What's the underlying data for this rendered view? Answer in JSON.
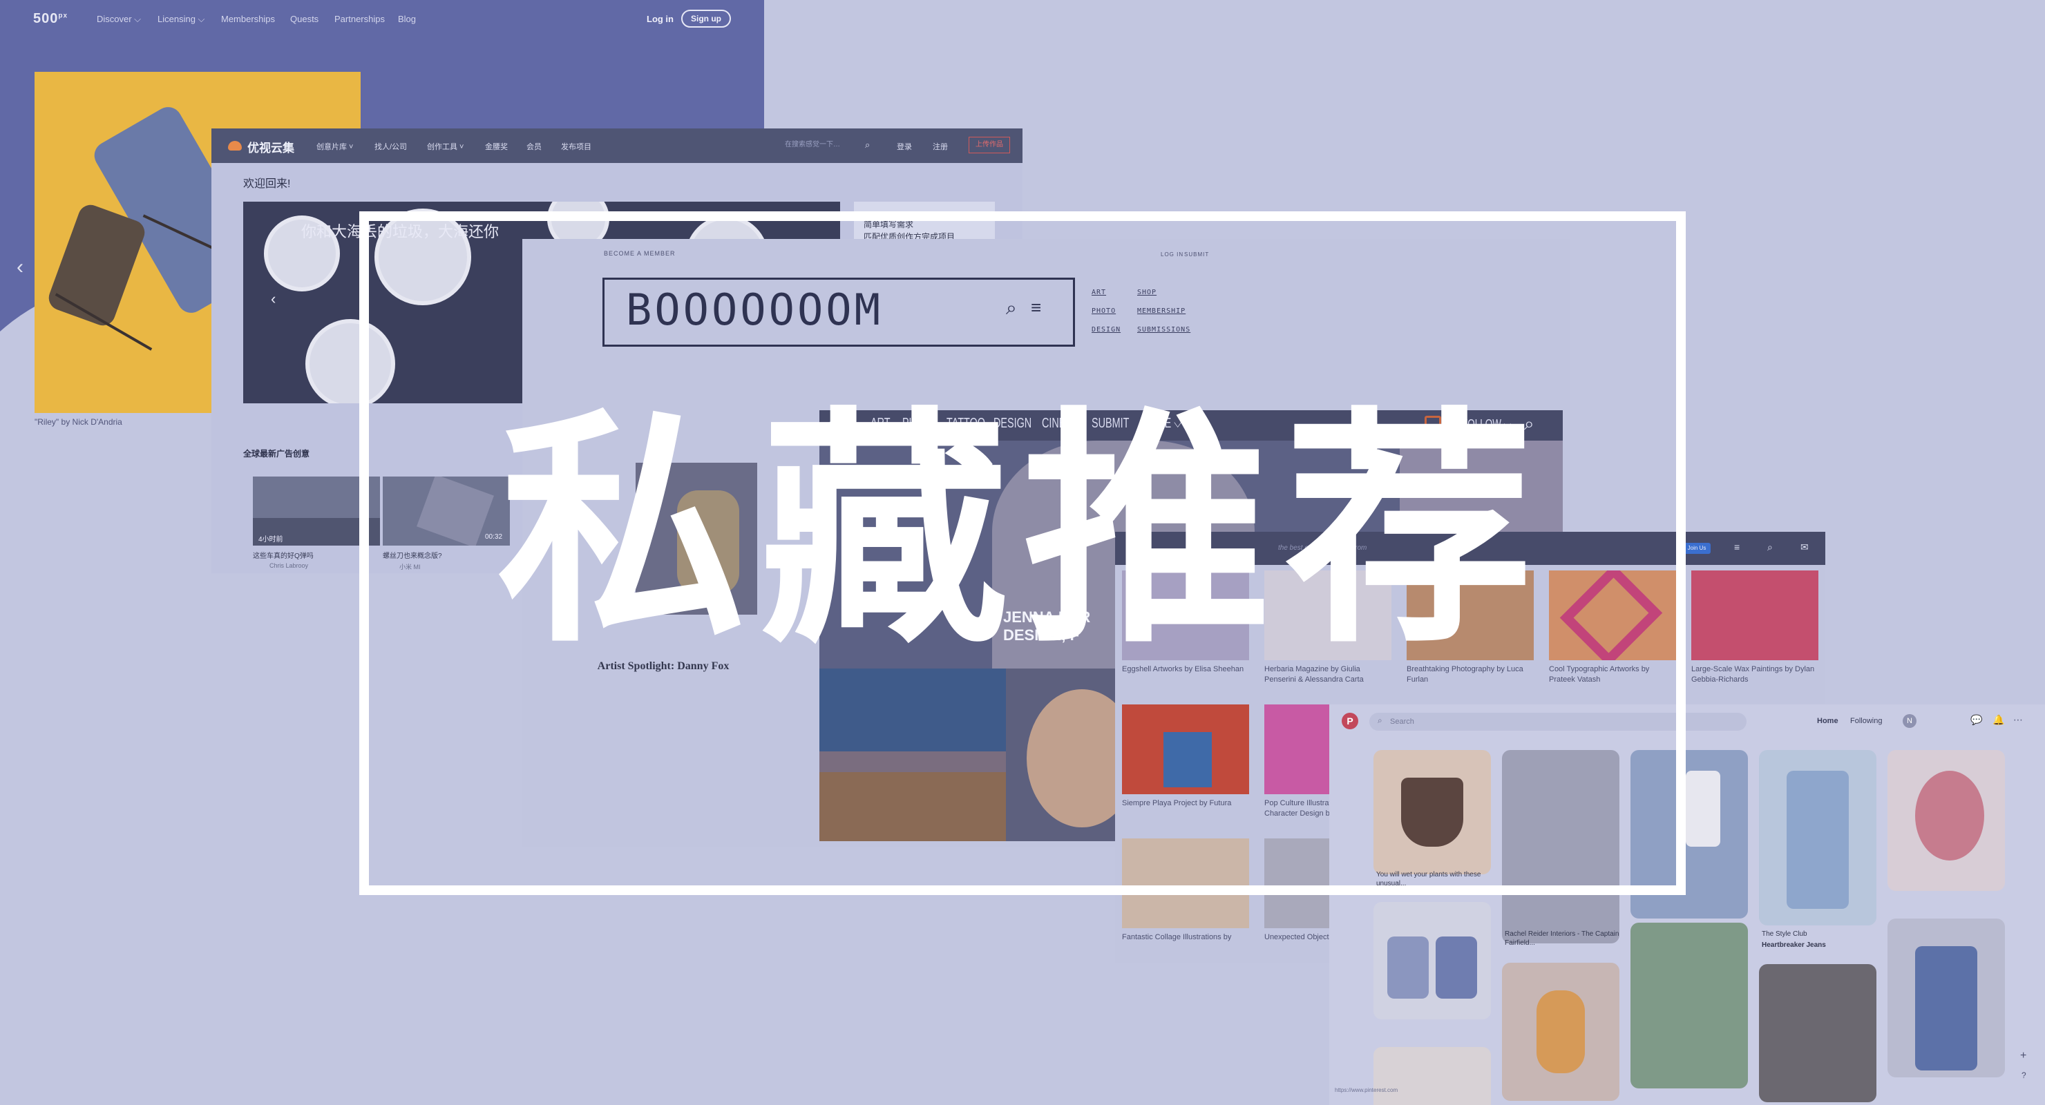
{
  "colors": {
    "background": "#c2c6e0",
    "overlay_text": "#ffffff",
    "accent_500px": "#6169a6",
    "pinterest_red": "#c2485b"
  },
  "site_500px": {
    "logo": "500",
    "logo_sup": "px",
    "nav": [
      "Discover ⌵",
      "Licensing ⌵",
      "Memberships",
      "Quests",
      "Partnerships",
      "Blog"
    ],
    "login": "Log in",
    "signup": "Sign up",
    "caption": "\"Riley\" by Nick D'Andria",
    "prev_icon": "chevron-left-icon"
  },
  "site_youshi": {
    "brand": "优视云集",
    "nav": [
      "创意片库 ˅",
      "找人/公司",
      "创作工具 ˅",
      "金腰奖",
      "会员",
      "发布项目"
    ],
    "search_placeholder": "在搜索感觉一下…",
    "login": "登录",
    "register": "注册",
    "upload": "上传作品",
    "welcome": "欢迎回来!",
    "banner_text": "你和大海丢的垃圾，大海还你",
    "side_text_1": "简单填写需求",
    "side_text_2": "匹配优质创作方完成项目",
    "section_title": "全球最新广告创意",
    "videos": [
      {
        "title": "这些车真的好Q弹吗",
        "user": "Chris Labrooy",
        "duration": "4小时前"
      },
      {
        "title": "螺丝刀也来概念版?",
        "user": "小米 MI",
        "duration": "00:32"
      }
    ]
  },
  "site_booooooom": {
    "become_member": "BECOME A MEMBER",
    "login": "LOG IN",
    "submit": "SUBMIT",
    "logo": "BOOOOOOOM",
    "menu_left": [
      "ART",
      "PHOTO",
      "DESIGN"
    ],
    "menu_right": [
      "SHOP",
      "MEMBERSHIP",
      "SUBMISSIONS"
    ]
  },
  "site_colossal": {
    "nav": [
      "ART",
      "PHOTO",
      "TATTOO",
      "DESIGN",
      "CINEMA",
      "SUBMIT",
      "MORE ⌵"
    ],
    "follow": "FOLLOW ⌵",
    "hero_text_1": "JENNA KER",
    "hero_text_2": "DESIGN, F",
    "spotlight_title": "Artist Spotlight: Danny Fox"
  },
  "site_grid": {
    "tagline": "the best creative stories from",
    "pill": "Join Us",
    "items": [
      {
        "caption": "Eggshell Artworks by Elisa Sheehan"
      },
      {
        "caption": "Herbaria Magazine by Giulia Penserini & Alessandra Carta"
      },
      {
        "caption": "Breathtaking Photography by Luca Furlan"
      },
      {
        "caption": "Cool Typographic Artworks by Prateek Vatash"
      },
      {
        "caption": "Large-Scale Wax Paintings by Dylan Gebbia-Richards"
      },
      {
        "caption": "Siempre Playa Project by Futura"
      },
      {
        "caption": "Pop Culture Illustrations and Character Design by ..."
      },
      {
        "caption": "Fantastic Collage Illustrations by"
      },
      {
        "caption": "Unexpected Objects"
      }
    ]
  },
  "site_pinterest": {
    "logo": "P",
    "search_placeholder": "Search",
    "tab_home": "Home",
    "tab_following": "Following",
    "user": "N",
    "pins": [
      {
        "caption": "You will wet your plants with these unusual..."
      },
      {
        "caption": "Rachel Reider Interiors - The Captain Fairfield..."
      },
      {
        "caption": "The Style Club"
      },
      {
        "caption": "Heartbreaker Jeans"
      }
    ],
    "url": "https://www.pinterest.com"
  },
  "overlay": {
    "title": "私藏推荐"
  }
}
